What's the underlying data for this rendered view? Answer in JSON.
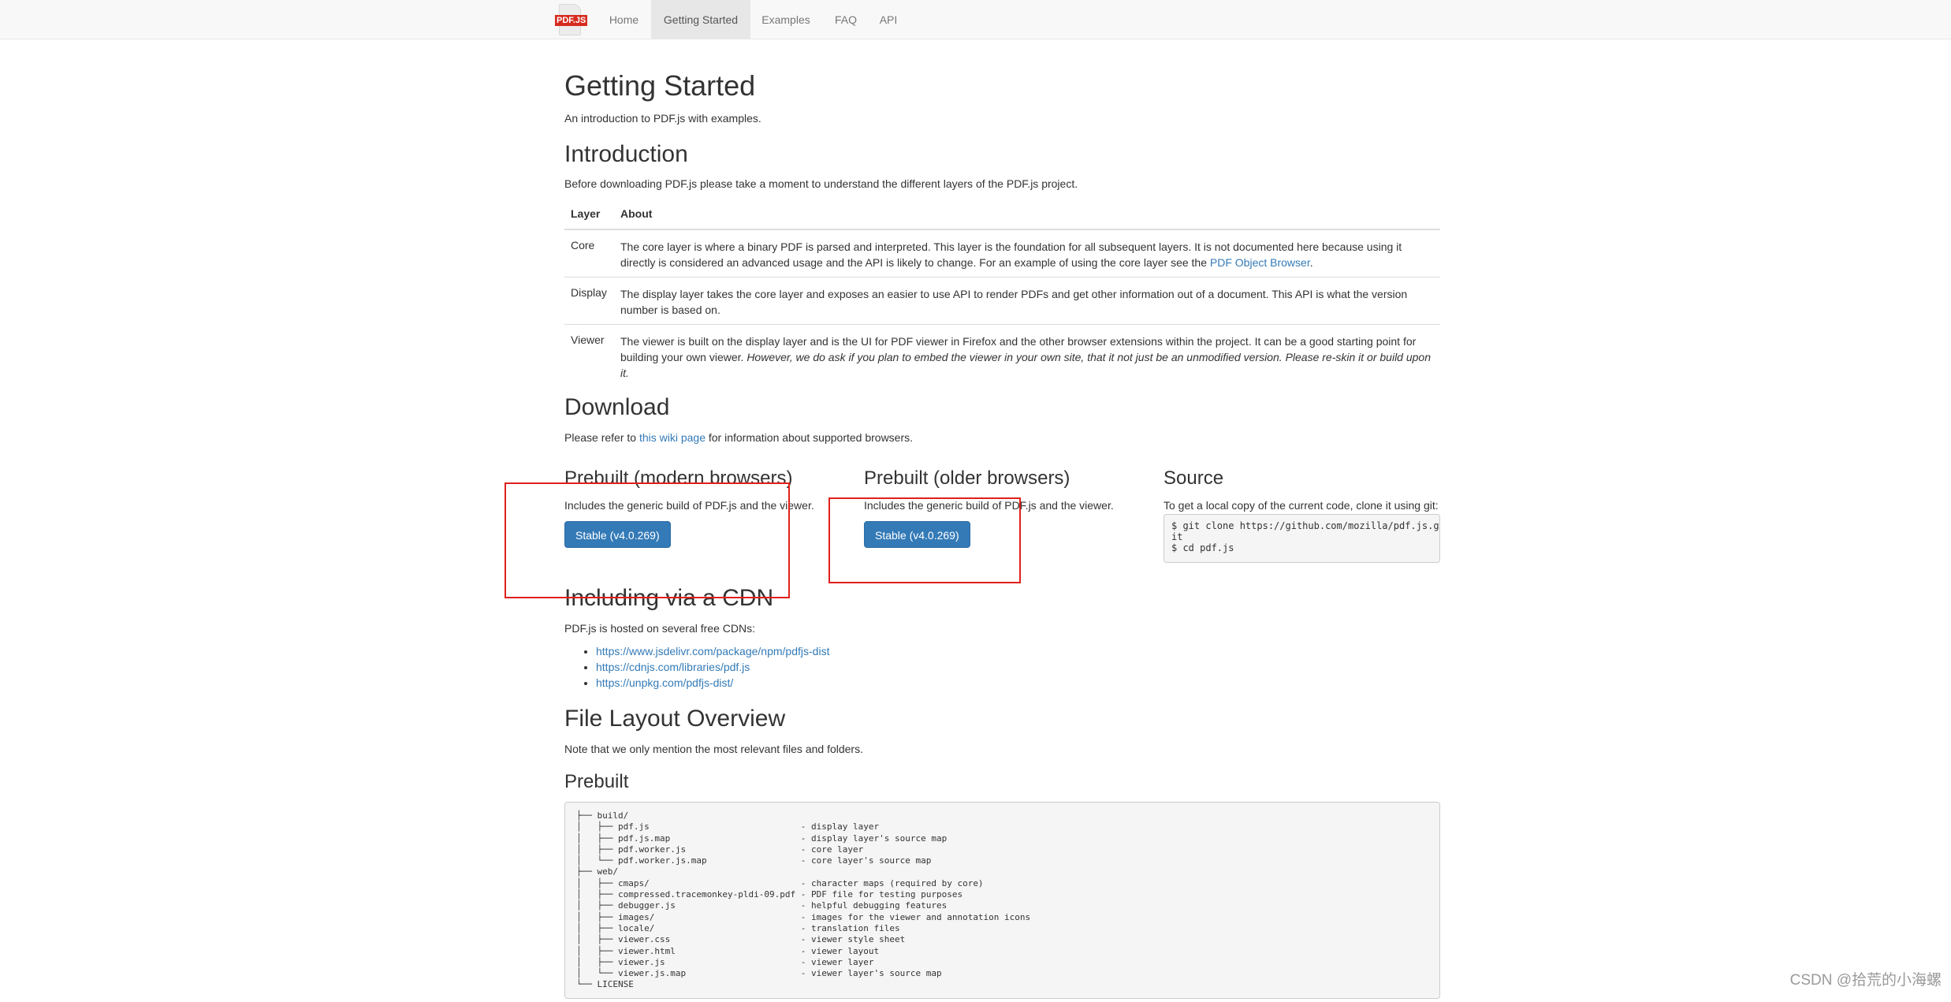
{
  "colors": {
    "link": "#337ab7",
    "button": "#337ab7",
    "annotation": "#e0201b"
  },
  "navbar": {
    "brand": "PDF.JS",
    "items": [
      {
        "label": "Home"
      },
      {
        "label": "Getting Started",
        "active": true
      },
      {
        "label": "Examples"
      },
      {
        "label": "FAQ"
      },
      {
        "label": "API"
      }
    ]
  },
  "page": {
    "title": "Getting Started",
    "subtitle": "An introduction to PDF.js with examples."
  },
  "introduction": {
    "heading": "Introduction",
    "text": "Before downloading PDF.js please take a moment to understand the different layers of the PDF.js project.",
    "table": {
      "headers": {
        "layer": "Layer",
        "about": "About"
      },
      "rows": [
        {
          "layer": "Core",
          "about": "The core layer is where a binary PDF is parsed and interpreted. This layer is the foundation for all subsequent layers. It is not documented here because using it directly is considered an advanced usage and the API is likely to change. For an example of using the core layer see the ",
          "link": "PDF Object Browser",
          "after": "."
        },
        {
          "layer": "Display",
          "about": "The display layer takes the core layer and exposes an easier to use API to render PDFs and get other information out of a document. This API is what the version number is based on."
        },
        {
          "layer": "Viewer",
          "about": "The viewer is built on the display layer and is the UI for PDF viewer in Firefox and the other browser extensions within the project. It can be a good starting point for building your own viewer. ",
          "emphasis": "However, we do ask if you plan to embed the viewer in your own site, that it not just be an unmodified version. Please re-skin it or build upon it."
        }
      ]
    }
  },
  "download": {
    "heading": "Download",
    "text_before": "Please refer to ",
    "link": "this wiki page",
    "text_after": " for information about supported browsers.",
    "modern": {
      "heading": "Prebuilt (modern browsers)",
      "text": "Includes the generic build of PDF.js and the viewer.",
      "button": "Stable (v4.0.269)"
    },
    "older": {
      "heading": "Prebuilt (older browsers)",
      "text": "Includes the generic build of PDF.js and the viewer.",
      "button": "Stable (v4.0.269)"
    },
    "source": {
      "heading": "Source",
      "text": "To get a local copy of the current code, clone it using git:",
      "code": "$ git clone https://github.com/mozilla/pdf.js.g\nit\n$ cd pdf.js"
    }
  },
  "cdn": {
    "heading": "Including via a CDN",
    "text": "PDF.js is hosted on several free CDNs:",
    "links": [
      "https://www.jsdelivr.com/package/npm/pdfjs-dist",
      "https://cdnjs.com/libraries/pdf.js",
      "https://unpkg.com/pdfjs-dist/"
    ]
  },
  "file_layout": {
    "heading": "File Layout Overview",
    "text": "Note that we only mention the most relevant files and folders.",
    "prebuilt_heading": "Prebuilt",
    "tree": "├── build/\n│   ├── pdf.js                             - display layer\n│   ├── pdf.js.map                         - display layer's source map\n│   ├── pdf.worker.js                      - core layer\n│   └── pdf.worker.js.map                  - core layer's source map\n├── web/\n│   ├── cmaps/                             - character maps (required by core)\n│   ├── compressed.tracemonkey-pldi-09.pdf - PDF file for testing purposes\n│   ├── debugger.js                        - helpful debugging features\n│   ├── images/                            - images for the viewer and annotation icons\n│   ├── locale/                            - translation files\n│   ├── viewer.css                         - viewer style sheet\n│   ├── viewer.html                        - viewer layout\n│   ├── viewer.js                          - viewer layer\n│   └── viewer.js.map                      - viewer layer's source map\n└── LICENSE"
  },
  "watermark": "CSDN @拾荒的小海螺"
}
